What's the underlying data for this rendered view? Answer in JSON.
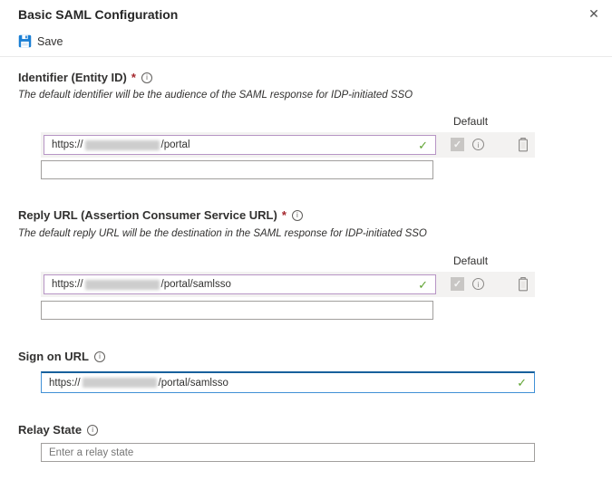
{
  "panel": {
    "title": "Basic SAML Configuration",
    "close_glyph": "✕"
  },
  "toolbar": {
    "save_label": "Save"
  },
  "icons": {
    "info_glyph": "i",
    "valid_check_glyph": "✓",
    "checkbox_check_glyph": "✓"
  },
  "colors": {
    "accent_blue": "#0078d4",
    "valid_green": "#5fa332",
    "modified_purple": "#b795c5",
    "required_red": "#a4262c",
    "row_background": "#f3f2f1"
  },
  "sections": {
    "identifier": {
      "label": "Identifier (Entity ID)",
      "required_marker": "*",
      "description": "The default identifier will be the audience of the SAML response for IDP-initiated SSO",
      "default_column_header": "Default",
      "rows": [
        {
          "url_prefix": "https://",
          "url_suffix": "/portal",
          "valid": true,
          "default_checked": true
        }
      ],
      "new_entry_value": ""
    },
    "reply_url": {
      "label": "Reply URL (Assertion Consumer Service URL)",
      "required_marker": "*",
      "description": "The default reply URL will be the destination in the SAML response for IDP-initiated SSO",
      "default_column_header": "Default",
      "rows": [
        {
          "url_prefix": "https://",
          "url_suffix": "/portal/samlsso",
          "valid": true,
          "default_checked": true
        }
      ],
      "new_entry_value": ""
    },
    "sign_on_url": {
      "label": "Sign on URL",
      "value_prefix": "https://",
      "value_suffix": "/portal/samlsso",
      "valid": true
    },
    "relay_state": {
      "label": "Relay State",
      "placeholder": "Enter a relay state",
      "value": ""
    }
  }
}
